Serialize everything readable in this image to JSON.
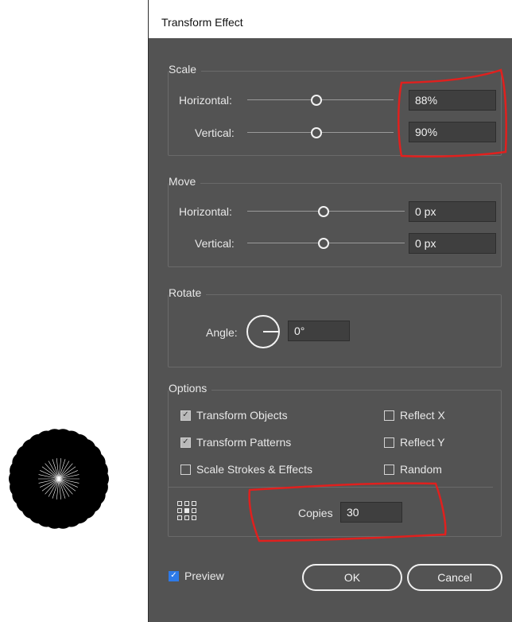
{
  "dialog": {
    "title": "Transform Effect"
  },
  "scale": {
    "title": "Scale",
    "horizontal_label": "Horizontal:",
    "vertical_label": "Vertical:",
    "horizontal_value": "88%",
    "vertical_value": "90%"
  },
  "move": {
    "title": "Move",
    "horizontal_label": "Horizontal:",
    "vertical_label": "Vertical:",
    "horizontal_value": "0 px",
    "vertical_value": "0 px"
  },
  "rotate": {
    "title": "Rotate",
    "angle_label": "Angle:",
    "angle_value": "0°"
  },
  "options": {
    "title": "Options",
    "transform_objects": {
      "label": "Transform Objects",
      "checked": true
    },
    "transform_patterns": {
      "label": "Transform Patterns",
      "checked": true
    },
    "scale_strokes": {
      "label": "Scale Strokes & Effects",
      "checked": false
    },
    "reflect_x": {
      "label": "Reflect X",
      "checked": false
    },
    "reflect_y": {
      "label": "Reflect Y",
      "checked": false
    },
    "random": {
      "label": "Random",
      "checked": false
    },
    "copies_label": "Copies",
    "copies_value": "30"
  },
  "footer": {
    "preview_label": "Preview",
    "preview_checked": true,
    "ok_label": "OK",
    "cancel_label": "Cancel"
  },
  "colors": {
    "dialog_bg": "#535353",
    "field_bg": "#3f3f3f",
    "annotation_red": "#e0201e",
    "preview_blue": "#2d7ae8"
  },
  "icons": [
    "flower-artwork",
    "reference-point-icon",
    "check-icon",
    "angle-dial-icon"
  ]
}
